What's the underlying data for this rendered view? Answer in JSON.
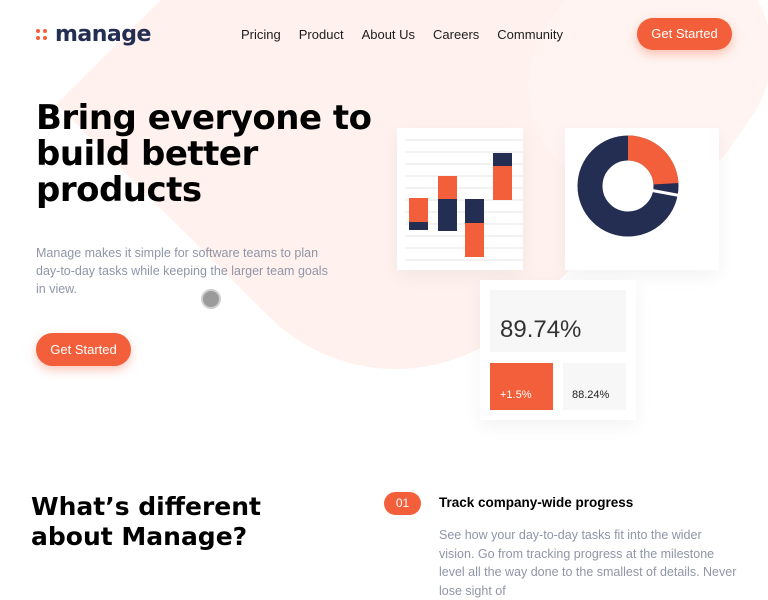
{
  "header": {
    "logo_text": "manage",
    "nav": [
      "Pricing",
      "Product",
      "About Us",
      "Careers",
      "Community"
    ],
    "cta_label": "Get Started"
  },
  "hero": {
    "title": "Bring everyone to build better products",
    "description": "Manage makes it simple for software teams to plan day-to-day tasks while keeping the larger team goals in view.",
    "cta_label": "Get Started"
  },
  "dashboard": {
    "stat_main": "89.74%",
    "stat_change": "+1.5%",
    "stat_secondary": "88.24%",
    "donut_share": 0.24,
    "colors": {
      "accent": "#f25f3a",
      "navy": "#242d52"
    }
  },
  "features": {
    "section_title": "What’s different about Manage?",
    "items": [
      {
        "number": "01",
        "title": "Track company-wide progress",
        "description": "See how your day-to-day tasks fit into the wider vision. Go from tracking progress at the milestone level all the way done to the smallest of details. Never lose sight of"
      }
    ]
  }
}
